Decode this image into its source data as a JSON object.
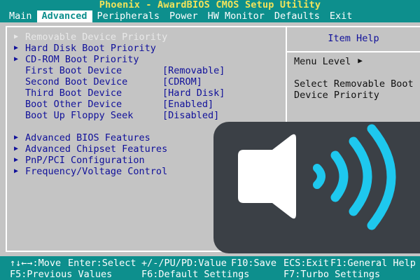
{
  "app": {
    "title": "Phoenix - AwardBIOS CMOS Setup Utility"
  },
  "menu": [
    {
      "label": "Main",
      "active": false
    },
    {
      "label": "Advanced",
      "active": true
    },
    {
      "label": "Peripherals",
      "active": false
    },
    {
      "label": "Power",
      "active": false
    },
    {
      "label": "HW Monitor",
      "active": false
    },
    {
      "label": "Defaults",
      "active": false
    },
    {
      "label": "Exit",
      "active": false
    }
  ],
  "left": {
    "items": [
      {
        "label": "Removable Device Priority",
        "submenu": true,
        "highlight": true
      },
      {
        "label": "Hard Disk Boot Priority",
        "submenu": true
      },
      {
        "label": "CD-ROM Boot Priority",
        "submenu": true
      },
      {
        "label": "First Boot Device",
        "value": "[Removable]"
      },
      {
        "label": "Second Boot Device",
        "value": "[CDROM]"
      },
      {
        "label": "Third Boot Device",
        "value": "[Hard Disk]"
      },
      {
        "label": "Boot Other Device",
        "value": "[Enabled]"
      },
      {
        "label": "Boot Up Floppy Seek",
        "value": "[Disabled]"
      }
    ],
    "items2": [
      {
        "label": "Advanced BIOS Features",
        "submenu": true
      },
      {
        "label": "Advanced Chipset Features",
        "submenu": true
      },
      {
        "label": "PnP/PCI Configuration",
        "submenu": true
      },
      {
        "label": "Frequency/Voltage Control",
        "submenu": true
      }
    ]
  },
  "help": {
    "title": "Item Help",
    "menu_level_label": "Menu Level",
    "menu_level_arrow": "▶",
    "description": "Select Removable Boot Device Priority"
  },
  "footer": {
    "row1": [
      {
        "label": "↑↓←→:Move"
      },
      {
        "label": "Enter:Select"
      },
      {
        "label": "+/-/PU/PD:Value"
      },
      {
        "label": "F10:Save"
      },
      {
        "label": "ECS:Exit"
      },
      {
        "label": "F1:General Help"
      }
    ],
    "row2": [
      {
        "label": "F5:Previous Values"
      },
      {
        "label": "F6:Default Settings"
      },
      {
        "label": "F7:Turbo Settings"
      }
    ]
  },
  "overlay": {
    "icon": "speaker-volume-icon",
    "icon_color": "#ffffff",
    "wave_color": "#1ec8ee",
    "background": "#3b4046"
  },
  "colors": {
    "bios_teal": "#0d8f8d",
    "panel_gray": "#c4c4c4",
    "label_blue": "#10109a",
    "title_yellow": "#f2e35a"
  }
}
